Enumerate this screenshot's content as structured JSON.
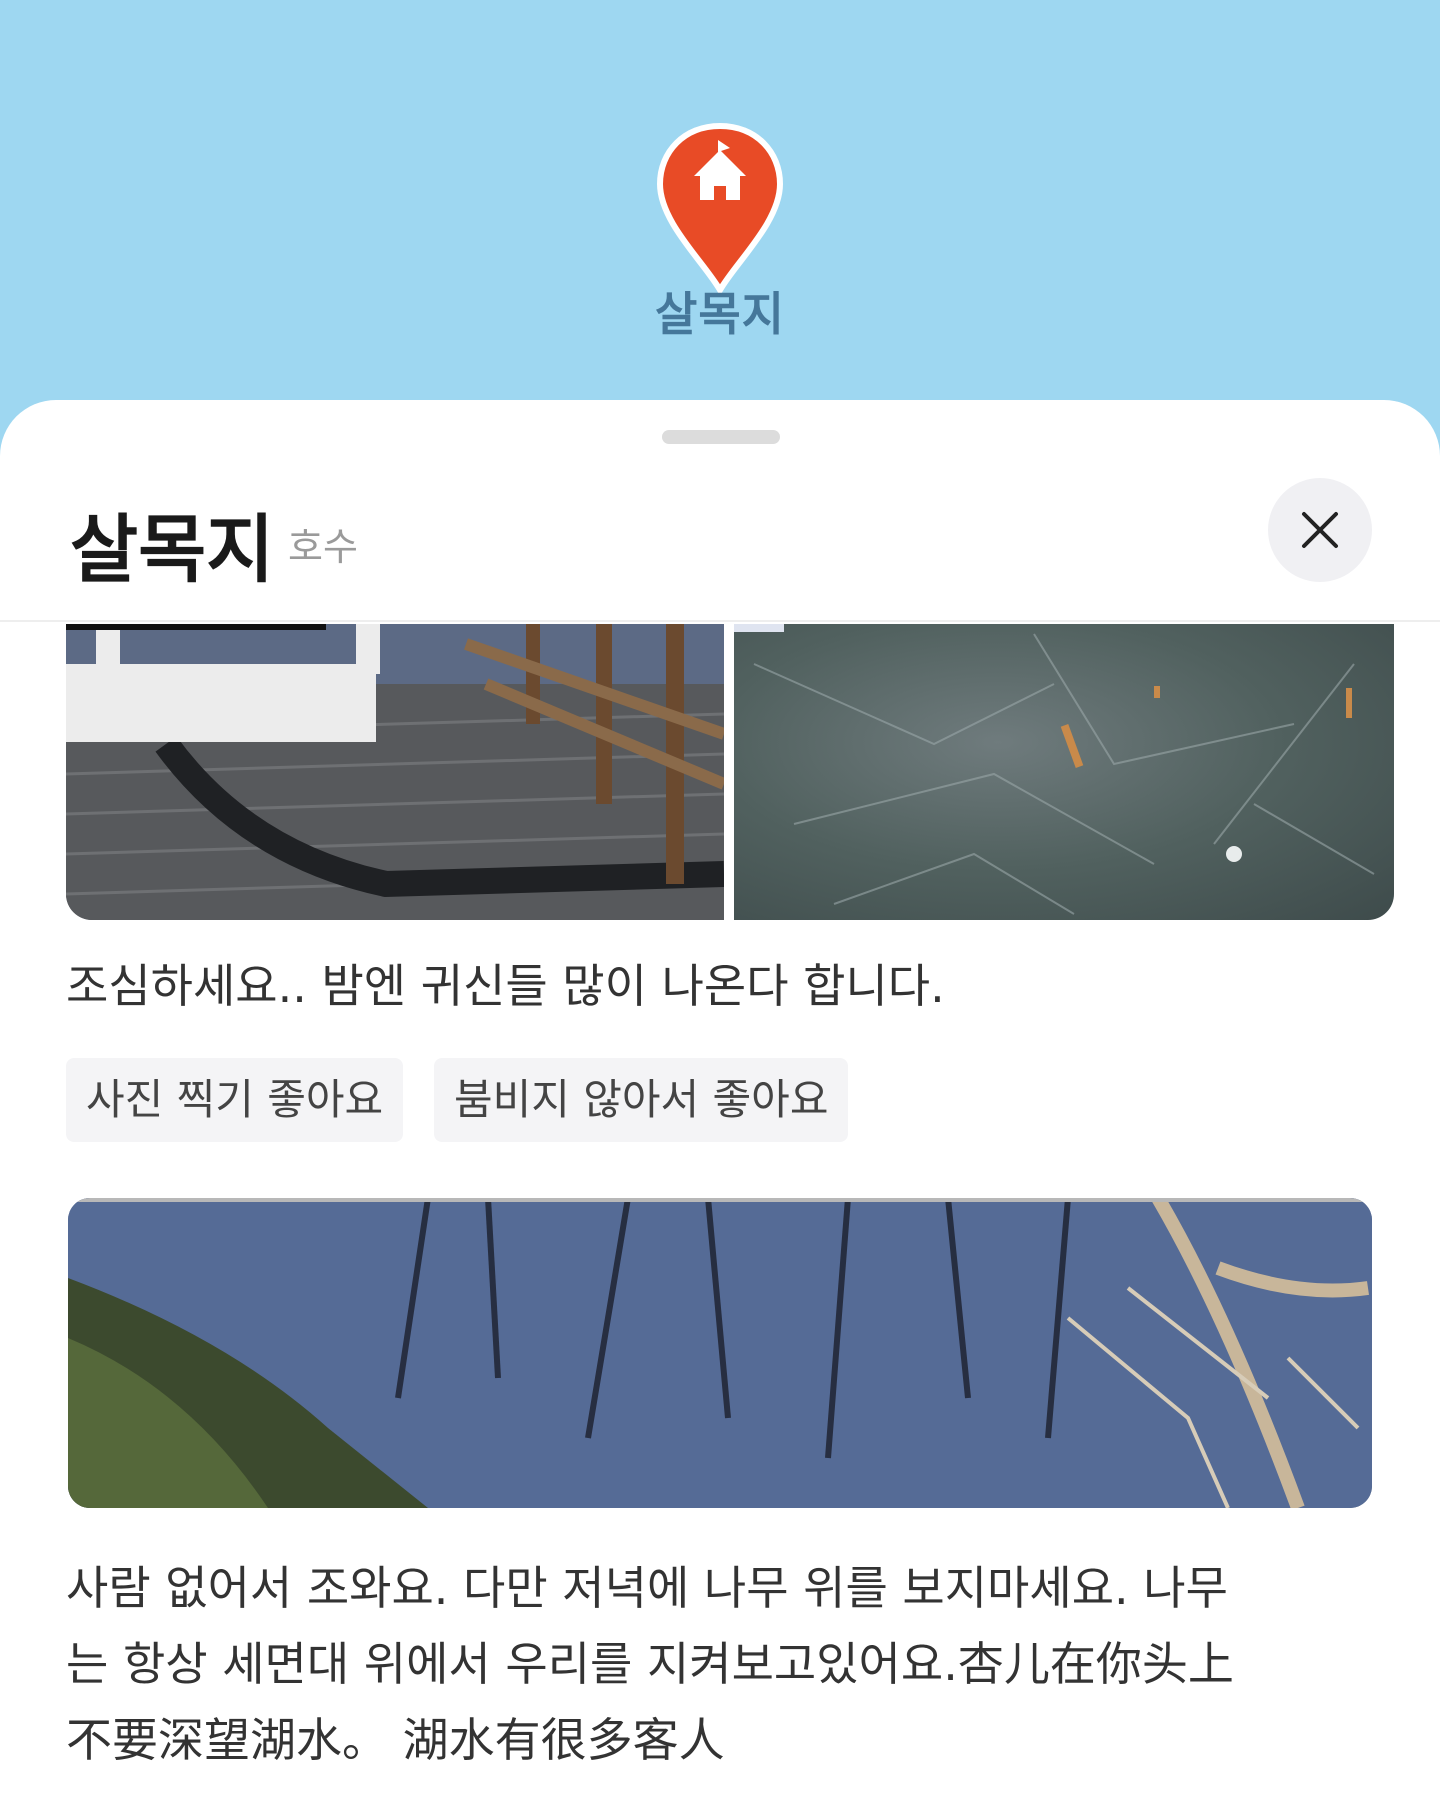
{
  "map": {
    "pin_label": "살목지",
    "pin_color": "#e84b26",
    "background_color": "#9ed7f1"
  },
  "sheet": {
    "title": "살목지",
    "category": "호수",
    "close_icon": "close-icon"
  },
  "reviews": [
    {
      "text": "조심하세요.. 밤엔 귀신들 많이 나온다 합니다.",
      "tags": [
        "사진 찍기 좋아요",
        "붐비지 않아서 좋아요"
      ],
      "photos": [
        "boardwalk-photo",
        "frozen-lake-photo"
      ]
    },
    {
      "text_lines": [
        "사람 없어서 조와요. 다만 저녁에 나무 위를 보지마세요. 나무",
        "는 항상 세면대 위에서 우리를 지켜보고있어요.杏儿在你头上",
        "不要深望湖水。 湖水有很多客人"
      ],
      "photos": [
        "lake-trees-reflection-photo"
      ]
    }
  ]
}
